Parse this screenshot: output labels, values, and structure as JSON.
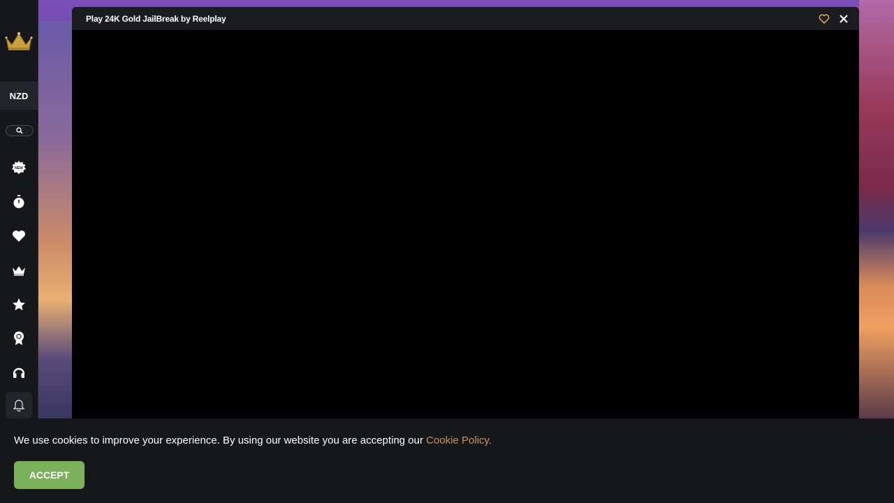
{
  "modal": {
    "title": "Play 24K Gold JailBreak by Reelplay"
  },
  "sidebar": {
    "currency": "NZD",
    "icons": [
      "crown-logo-icon",
      "search-icon",
      "new-badge-icon",
      "stopwatch-icon",
      "heart-icon",
      "crown-icon",
      "star-icon",
      "award-ribbon-icon",
      "headset-icon",
      "bell-icon"
    ]
  },
  "cookie": {
    "text": "We use cookies to improve your experience. By using our website you are accepting our ",
    "link": "Cookie Policy.",
    "accept": "ACCEPT"
  },
  "colors": {
    "accent": "#c9955c",
    "accept": "#7ab05a",
    "sidebar_bg": "#16171b"
  }
}
